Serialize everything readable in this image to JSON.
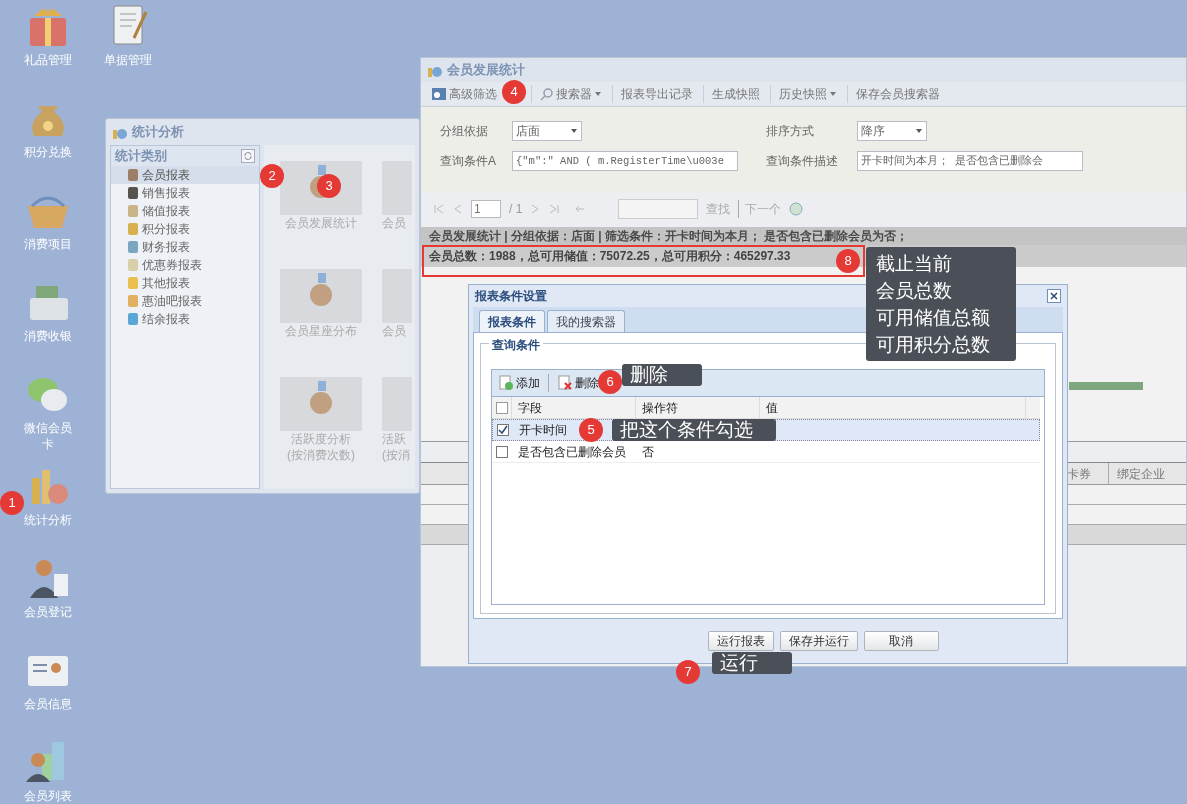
{
  "desktop": {
    "icons_left": [
      {
        "label": "礼品管理"
      },
      {
        "label": "积分兑换"
      },
      {
        "label": "消费项目"
      },
      {
        "label": "消费收银"
      },
      {
        "label": "微信会员卡"
      },
      {
        "label": "统计分析"
      },
      {
        "label": "会员登记"
      },
      {
        "label": "会员信息"
      },
      {
        "label": "会员列表"
      }
    ],
    "icons_right": [
      {
        "label": "单据管理"
      }
    ]
  },
  "stats_window": {
    "title": "统计分析",
    "category_panel": {
      "title": "统计类别",
      "items": [
        {
          "label": "会员报表",
          "selected": true
        },
        {
          "label": "销售报表",
          "selected": false
        },
        {
          "label": "储值报表",
          "selected": false
        },
        {
          "label": "积分报表",
          "selected": false
        },
        {
          "label": "财务报表",
          "selected": false
        },
        {
          "label": "优惠券报表",
          "selected": false
        },
        {
          "label": "其他报表",
          "selected": false
        },
        {
          "label": "惠油吧报表",
          "selected": false
        },
        {
          "label": "结余报表",
          "selected": false
        }
      ]
    },
    "tiles": [
      [
        {
          "lines": [
            "会员发展统计"
          ]
        },
        {
          "lines": [
            "会员"
          ]
        }
      ],
      [
        {
          "lines": [
            "会员星座分布"
          ]
        },
        {
          "lines": [
            "会员"
          ]
        }
      ],
      [
        {
          "lines": [
            "活跃度分析",
            "(按消费次数)"
          ]
        },
        {
          "lines": [
            "活跃",
            "(按消"
          ]
        }
      ]
    ]
  },
  "report_window": {
    "title": "会员发展统计",
    "toolbar": [
      {
        "label": "高级筛选",
        "dropdown": false
      },
      {
        "label": "搜索器",
        "dropdown": true
      },
      {
        "label": "报表导出记录",
        "dropdown": false
      },
      {
        "label": "生成快照",
        "dropdown": false
      },
      {
        "label": "历史快照",
        "dropdown": true
      },
      {
        "label": "保存会员搜索器",
        "dropdown": false
      }
    ],
    "form": [
      {
        "label": "分组依据",
        "value": "店面",
        "kind": "select"
      },
      {
        "label": "排序方式",
        "value": "降序",
        "kind": "select"
      },
      {
        "label": "查询条件A",
        "value": "{\"m\":\" AND ( m.RegisterTime\\u003e",
        "kind": "text"
      },
      {
        "label": "查询条件描述",
        "value": "开卡时间为本月； 是否包含已删除会",
        "kind": "text"
      }
    ],
    "pager": {
      "page": "1",
      "total": "/ 1",
      "find": "查找",
      "next": "下一个"
    },
    "report_header": "会员发展统计 | 分组依据：店面 | 筛选条件：开卡时间为本月； 是否包含已删除会员为否；",
    "summary": "会员总数：1988，总可用储值：75072.25，总可用积分：465297.33",
    "table_columns": [
      "卡券",
      "绑定企业"
    ]
  },
  "dialog": {
    "title": "报表条件设置",
    "tabs": [
      {
        "label": "报表条件",
        "selected": true
      },
      {
        "label": "我的搜索器",
        "selected": false
      }
    ],
    "group_title": "查询条件",
    "toolbar": [
      "添加",
      "删除"
    ],
    "columns": [
      "字段",
      "操作符",
      "值"
    ],
    "header_checked": false,
    "rows": [
      {
        "field": "开卡时间",
        "operator": "",
        "value": "",
        "checked": true,
        "selected": true
      },
      {
        "field": "是否包含已删除会员",
        "operator": "否",
        "value": "",
        "checked": false,
        "selected": false
      }
    ],
    "buttons": [
      "运行报表",
      "保存并运行",
      "取消"
    ]
  },
  "annotations": [
    {
      "number": "1"
    },
    {
      "number": "2"
    },
    {
      "number": "3"
    },
    {
      "number": "4"
    },
    {
      "number": "6",
      "note": [
        "删除"
      ]
    },
    {
      "number": "5",
      "note": [
        "把这个条件勾选"
      ]
    },
    {
      "number": "7",
      "note": [
        "运行"
      ]
    },
    {
      "number": "8",
      "note": [
        "截止当前",
        "会员总数",
        "可用储值总额",
        "可用积分总数"
      ]
    }
  ]
}
